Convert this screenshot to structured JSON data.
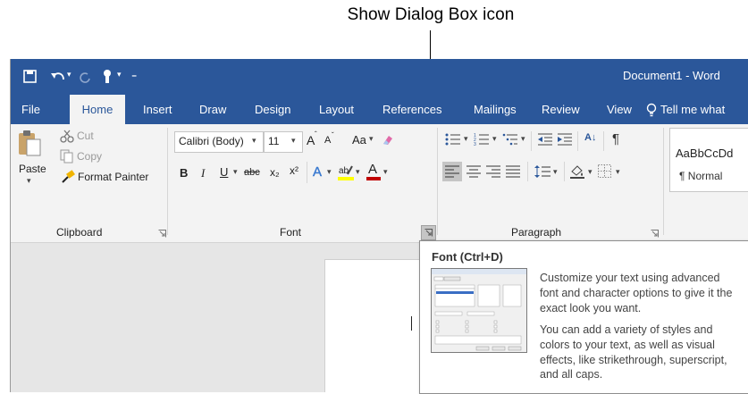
{
  "callout": {
    "label": "Show Dialog Box icon"
  },
  "titlebar": {
    "doc_title": "Document1 - Word",
    "qat": [
      "save-icon",
      "undo-icon",
      "redo-icon",
      "touch-mode-icon",
      "customize-icon"
    ]
  },
  "tabs": [
    {
      "label": "File"
    },
    {
      "label": "Home"
    },
    {
      "label": "Insert"
    },
    {
      "label": "Draw"
    },
    {
      "label": "Design"
    },
    {
      "label": "Layout"
    },
    {
      "label": "References"
    },
    {
      "label": "Mailings"
    },
    {
      "label": "Review"
    },
    {
      "label": "View"
    }
  ],
  "tellme": "Tell me what",
  "clipboard": {
    "paste": "Paste",
    "cut": "Cut",
    "copy": "Copy",
    "format_painter": "Format Painter",
    "group_label": "Clipboard"
  },
  "font": {
    "name": "Calibri (Body)",
    "size": "11",
    "case": "Aa",
    "bold": "B",
    "italic": "I",
    "underline": "U",
    "strike": "abc",
    "sub": "x₂",
    "sup": "x²",
    "text_effects": "A",
    "font_color": "A",
    "grow": "A",
    "shrink": "A",
    "group_label": "Font"
  },
  "paragraph": {
    "group_label": "Paragraph",
    "sort": "A↓",
    "pilcrow": "¶"
  },
  "styles": {
    "preview": "AaBbCcDd",
    "normal": "¶ Normal"
  },
  "tooltip": {
    "title": "Font (Ctrl+D)",
    "p1": "Customize your text using advanced font and character options to give it the exact look you want.",
    "p2": "You can add a variety of styles and colors to your text, as well as visual effects, like strikethrough, superscript, and all caps."
  },
  "colors": {
    "accent": "#2b579a",
    "ribbon": "#f3f3f3",
    "highlight": "#ffff00",
    "font_color": "#c00000"
  }
}
